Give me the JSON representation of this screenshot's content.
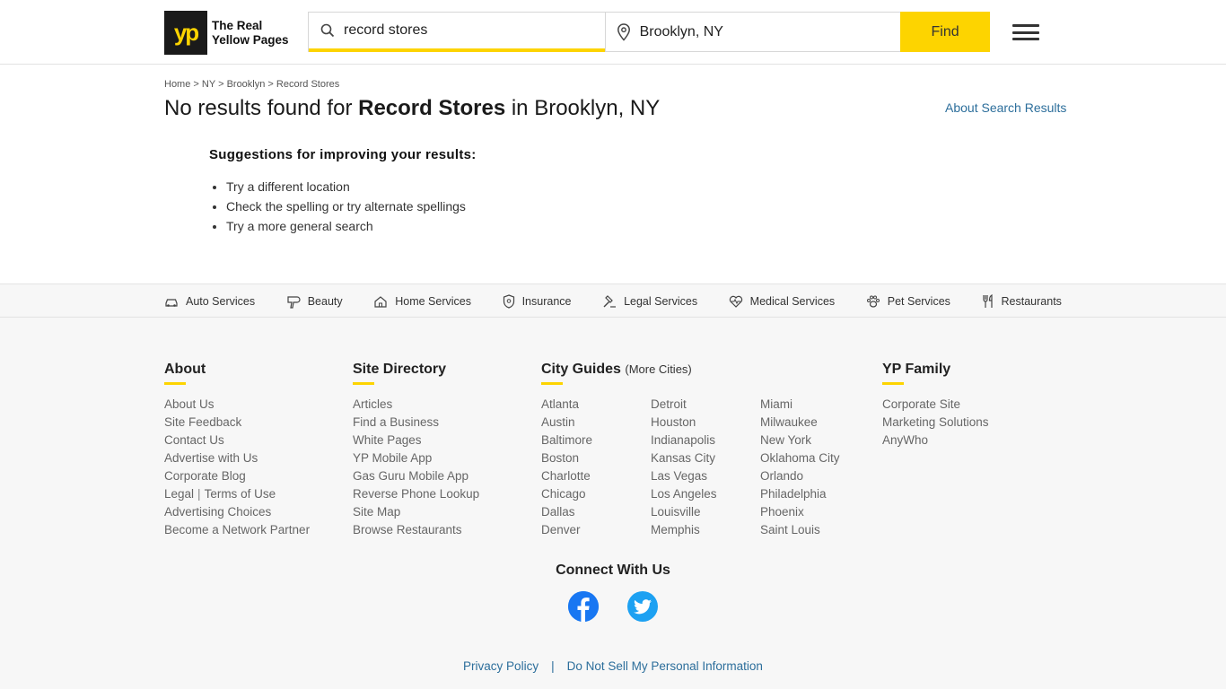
{
  "header": {
    "logo_mark": "yp",
    "logo_line1": "The Real",
    "logo_line2": "Yellow Pages",
    "search_value": "record stores",
    "location_value": "Brooklyn, NY",
    "find_label": "Find"
  },
  "breadcrumb": {
    "items": [
      "Home",
      "NY",
      "Brooklyn",
      "Record Stores"
    ],
    "separator": ">"
  },
  "main": {
    "headline_prefix": "No results found for",
    "headline_term": "Record Stores",
    "headline_suffix": "in Brooklyn, NY",
    "about_link": "About Search Results",
    "suggestions_title": "Suggestions for improving your results:",
    "suggestions": [
      "Try a different location",
      "Check the spelling or try alternate spellings",
      "Try a more general search"
    ]
  },
  "categories": [
    {
      "label": "Auto Services",
      "icon": "car-icon"
    },
    {
      "label": "Beauty",
      "icon": "hairdryer-icon"
    },
    {
      "label": "Home Services",
      "icon": "house-icon"
    },
    {
      "label": "Insurance",
      "icon": "shield-icon"
    },
    {
      "label": "Legal Services",
      "icon": "gavel-icon"
    },
    {
      "label": "Medical Services",
      "icon": "heart-pulse-icon"
    },
    {
      "label": "Pet Services",
      "icon": "paw-icon"
    },
    {
      "label": "Restaurants",
      "icon": "fork-knife-icon"
    }
  ],
  "footer": {
    "about": {
      "title": "About",
      "links": [
        "About Us",
        "Site Feedback",
        "Contact Us",
        "Advertise with Us",
        "Corporate Blog",
        "Legal",
        "Terms of Use",
        "Advertising Choices",
        "Become a Network Partner"
      ]
    },
    "directory": {
      "title": "Site Directory",
      "links": [
        "Articles",
        "Find a Business",
        "White Pages",
        "YP Mobile App",
        "Gas Guru Mobile App",
        "Reverse Phone Lookup",
        "Site Map",
        "Browse Restaurants"
      ]
    },
    "cities": {
      "title": "City Guides",
      "more": "(More Cities)",
      "col1": [
        "Atlanta",
        "Austin",
        "Baltimore",
        "Boston",
        "Charlotte",
        "Chicago",
        "Dallas",
        "Denver"
      ],
      "col2": [
        "Detroit",
        "Houston",
        "Indianapolis",
        "Kansas City",
        "Las Vegas",
        "Los Angeles",
        "Louisville",
        "Memphis"
      ],
      "col3": [
        "Miami",
        "Milwaukee",
        "New York",
        "Oklahoma City",
        "Orlando",
        "Philadelphia",
        "Phoenix",
        "Saint Louis"
      ]
    },
    "family": {
      "title": "YP Family",
      "links": [
        "Corporate Site",
        "Marketing Solutions",
        "AnyWho"
      ]
    },
    "connect": "Connect With Us",
    "legal_links": [
      "Privacy Policy",
      "Do Not Sell My Personal Information"
    ],
    "legal_separator": "|"
  },
  "colors": {
    "brand_yellow": "#fdd400",
    "link_blue": "#2c6e9b",
    "facebook": "#1877f2",
    "twitter": "#1da1f2"
  }
}
